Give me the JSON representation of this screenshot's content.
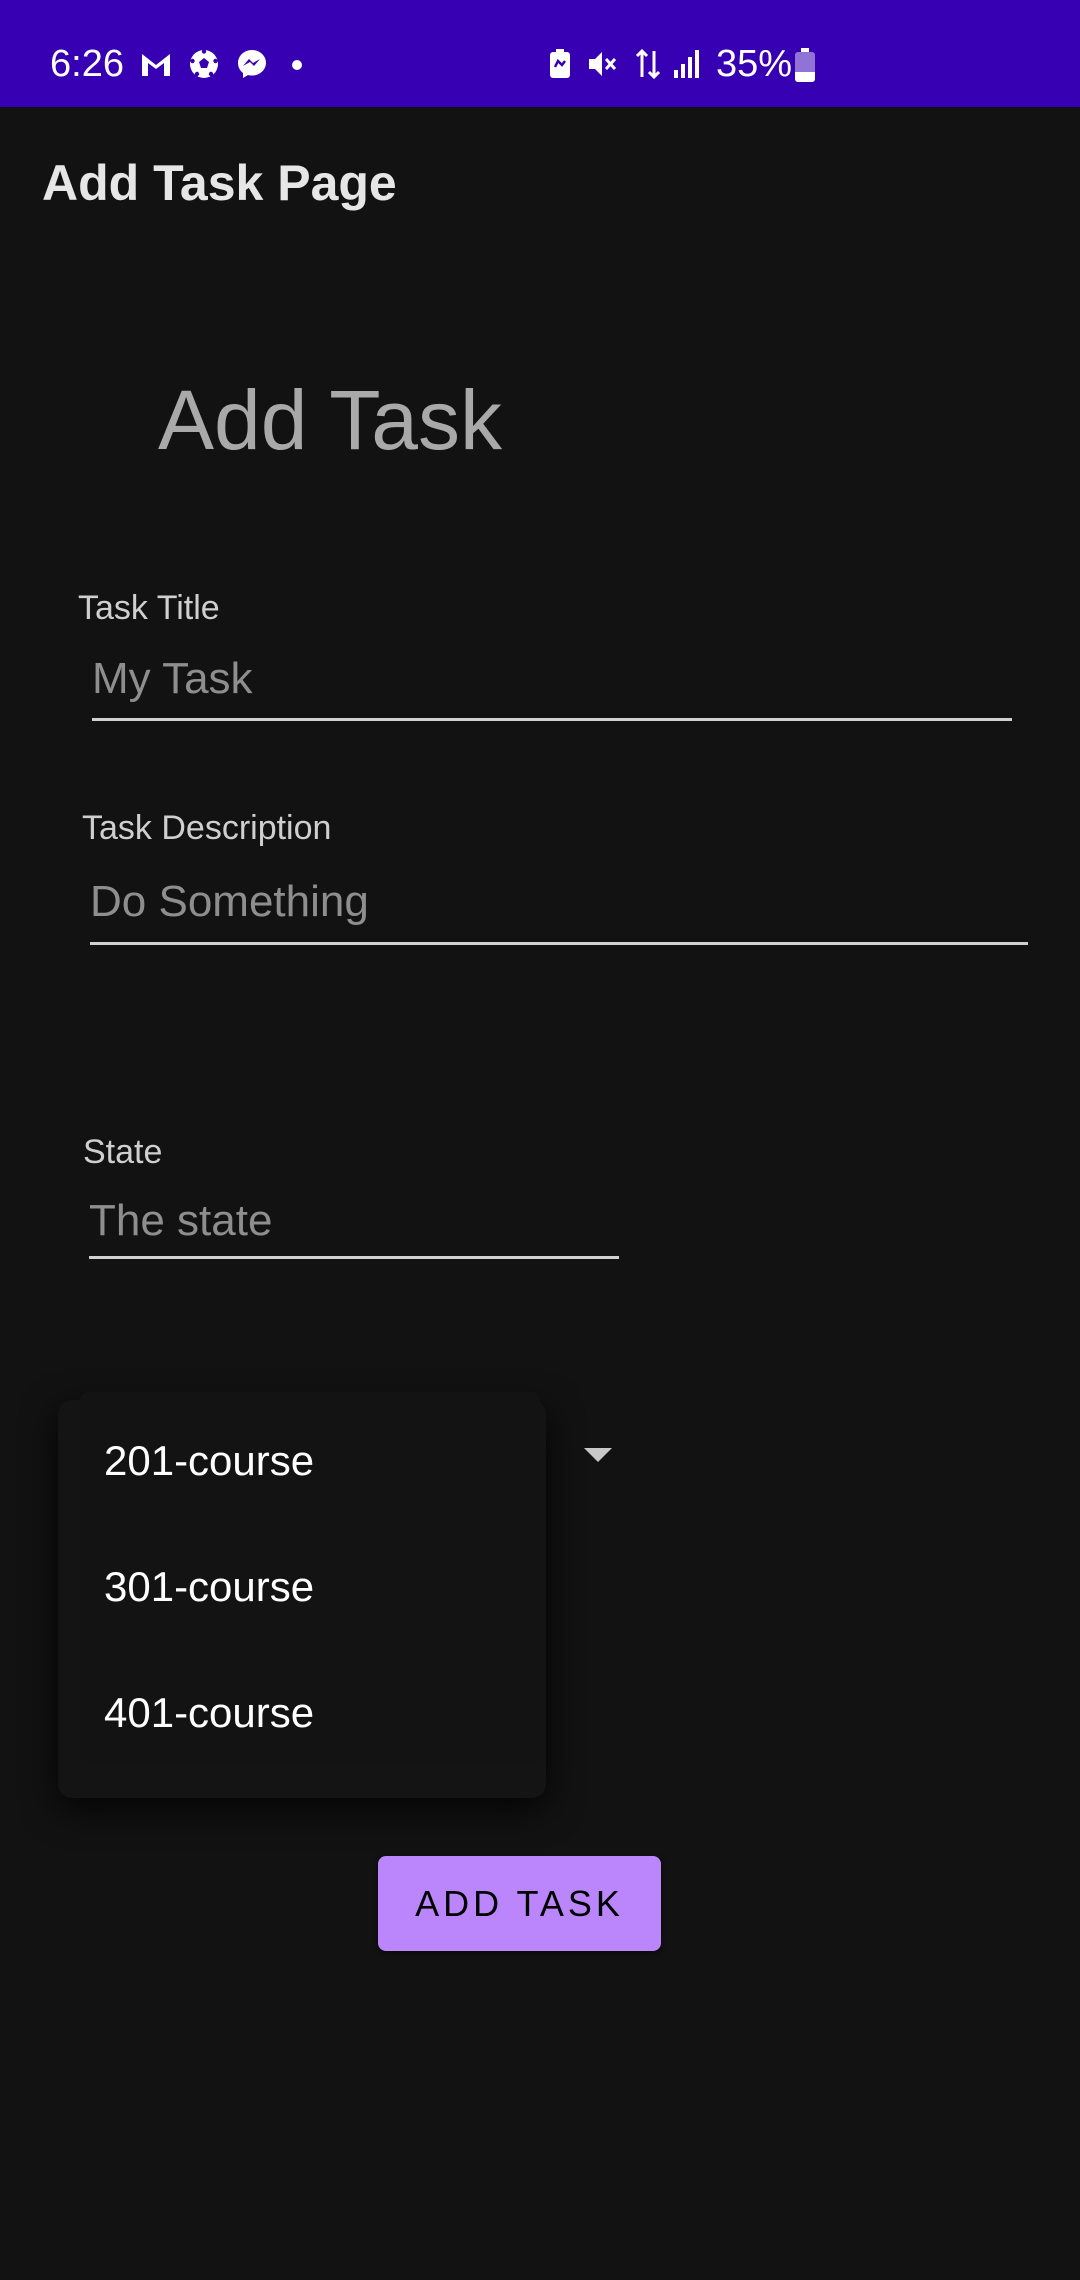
{
  "status_bar": {
    "time": "6:26",
    "battery_text": "35%",
    "battery_level": 0.35,
    "left_icons": [
      "gmail-like-icon",
      "soccer-ball-icon",
      "messenger-icon",
      "notification-dot-icon"
    ],
    "right_icons": [
      "battery-saver-icon",
      "mute-icon",
      "data-transfer-icon",
      "signal-icon",
      "battery-icon"
    ],
    "background_color": "#3700b3"
  },
  "app_bar": {
    "title": "Add Task Page"
  },
  "page": {
    "heading": "Add Task"
  },
  "form": {
    "title": {
      "label": "Task Title",
      "placeholder": "My Task",
      "value": ""
    },
    "description": {
      "label": "Task Description",
      "placeholder": "Do Something",
      "value": ""
    },
    "state": {
      "label": "State",
      "placeholder": "The state",
      "value": ""
    }
  },
  "course_dropdown": {
    "options": [
      "201-course",
      "301-course",
      "401-course"
    ],
    "expanded": true
  },
  "actions": {
    "add_task_label": "ADD TASK"
  },
  "colors": {
    "background": "#121212",
    "accent": "#bb86fc",
    "status_bar": "#3700b3"
  }
}
